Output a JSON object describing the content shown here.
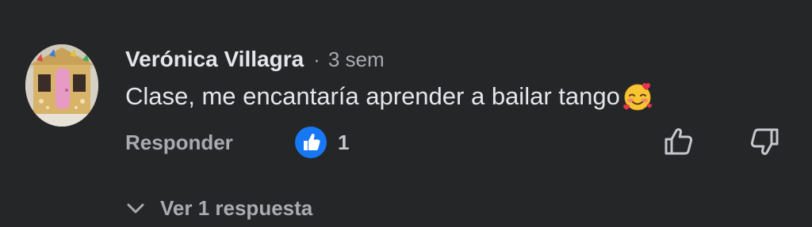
{
  "comment": {
    "author": "Verónica Villagra",
    "separator": "·",
    "time": "3 sem",
    "text": "Clase, me encantaría aprender a bailar tango",
    "emoji_icon": "smiling-face-with-hearts-icon",
    "reply_label": "Responder",
    "like_count": "1",
    "like_badge_icon": "thumbs-up-badge-icon",
    "like_button_icon": "thumbs-up-icon",
    "dislike_button_icon": "thumbs-down-icon",
    "view_replies_label": "Ver 1 respuesta"
  },
  "colors": {
    "background": "#252627",
    "primary_text": "#e4e6eb",
    "secondary_text": "#a8abb0",
    "like_blue": "#1877f2"
  }
}
